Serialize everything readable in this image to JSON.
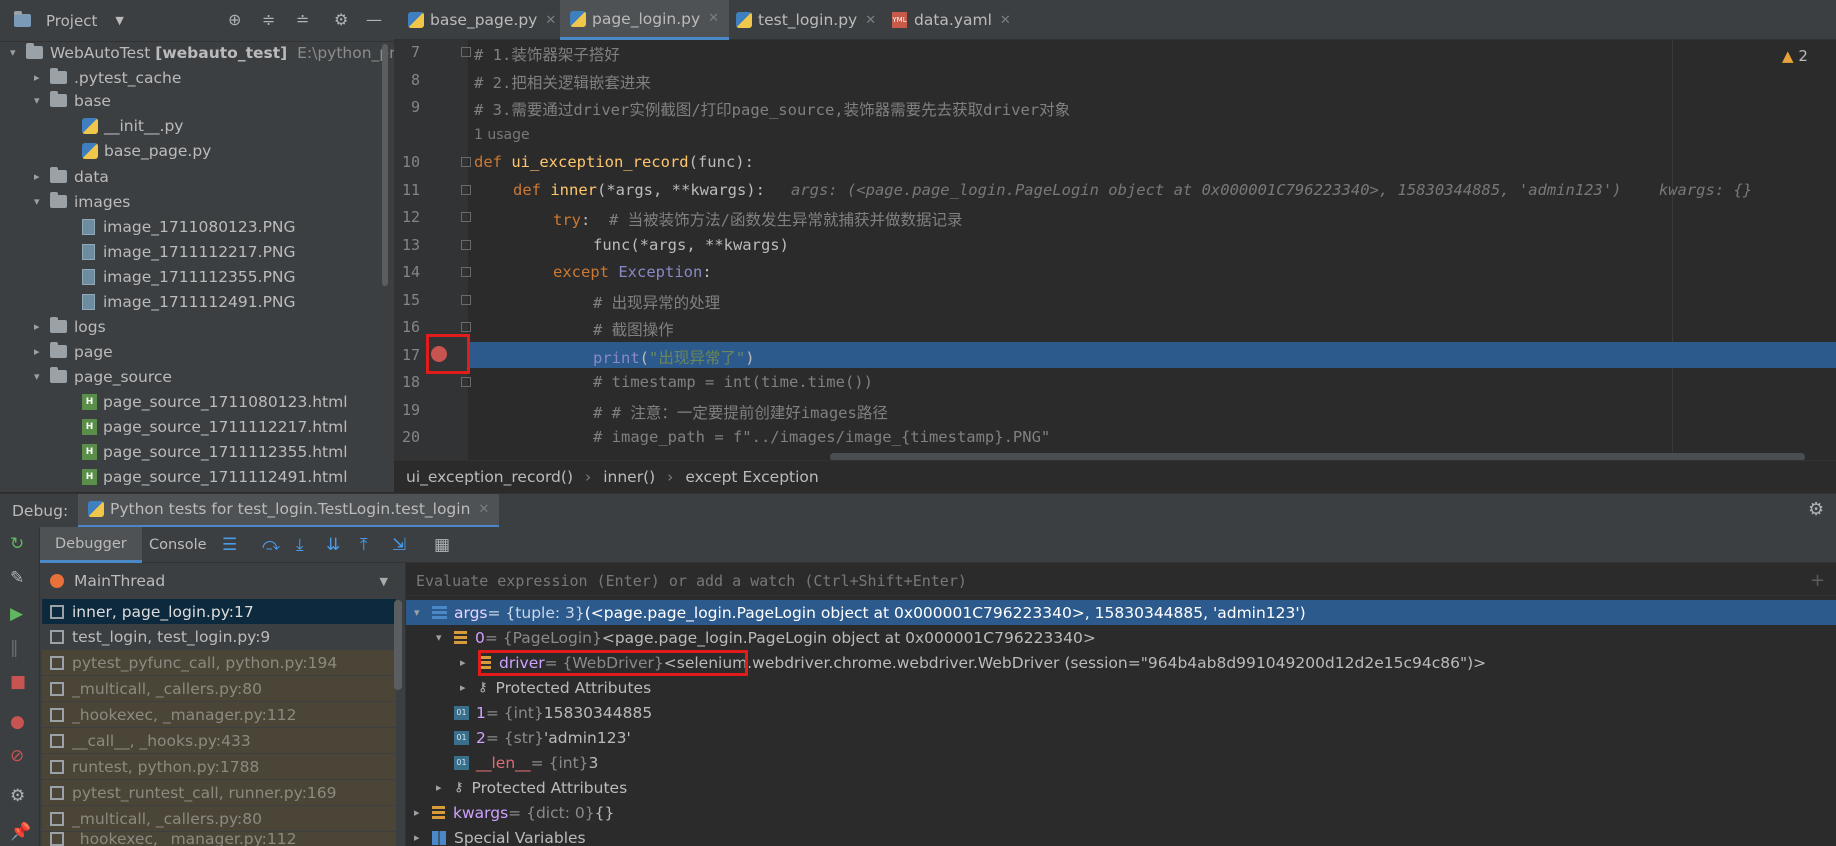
{
  "project_panel": {
    "title": "Project",
    "tree": [
      {
        "label": "WebAutoTest",
        "extra": "[webauto_test]",
        "path": "E:\\python_proj",
        "type": "root",
        "expanded": true
      },
      {
        "label": ".pytest_cache",
        "type": "folder",
        "expanded": false
      },
      {
        "label": "base",
        "type": "folder",
        "expanded": true
      },
      {
        "label": "__init__.py",
        "type": "py"
      },
      {
        "label": "base_page.py",
        "type": "py"
      },
      {
        "label": "data",
        "type": "folder",
        "expanded": false
      },
      {
        "label": "images",
        "type": "folder",
        "expanded": true
      },
      {
        "label": "image_1711080123.PNG",
        "type": "png"
      },
      {
        "label": "image_1711112217.PNG",
        "type": "png"
      },
      {
        "label": "image_1711112355.PNG",
        "type": "png"
      },
      {
        "label": "image_1711112491.PNG",
        "type": "png"
      },
      {
        "label": "logs",
        "type": "folder",
        "expanded": false
      },
      {
        "label": "page",
        "type": "folder",
        "expanded": false
      },
      {
        "label": "page_source",
        "type": "folder",
        "expanded": true
      },
      {
        "label": "page_source_1711080123.html",
        "type": "html"
      },
      {
        "label": "page_source_1711112217.html",
        "type": "html"
      },
      {
        "label": "page_source_1711112355.html",
        "type": "html"
      },
      {
        "label": "page_source_1711112491.html",
        "type": "html"
      }
    ]
  },
  "editor": {
    "tabs": [
      {
        "label": "base_page.py",
        "active": false
      },
      {
        "label": "page_login.py",
        "active": true
      },
      {
        "label": "test_login.py",
        "active": false
      },
      {
        "label": "data.yaml",
        "active": false
      }
    ],
    "warnings": "2",
    "usage_hint": "1 usage",
    "line_numbers": [
      "7",
      "8",
      "9",
      "10",
      "11",
      "12",
      "13",
      "14",
      "15",
      "16",
      "17",
      "18",
      "19",
      "20"
    ],
    "code": {
      "l7": "# 1.装饰器架子搭好",
      "l8": "# 2.把相关逻辑嵌套进来",
      "l9": "# 3.需要通过driver实例截图/打印page_source,装饰器需要先去获取driver对象",
      "l10_kw": "def ",
      "l10_fn": "ui_exception_record",
      "l10_rest": "(func):",
      "l11_kw": "def ",
      "l11_fn": "inner",
      "l11_rest": "(*args, **kwargs):",
      "l11_hint": "args: (<page.page_login.PageLogin object at 0x000001C796223340>, 15830344885, 'admin123')    kwargs: {}",
      "l12_kw": "try",
      "l12_rest": ":  ",
      "l12_cm": "# 当被装饰方法/函数发生异常就捕获并做数据记录",
      "l13": "func(*args, **kwargs)",
      "l14_kw": "except ",
      "l14_cls": "Exception",
      "l14_rest": ":",
      "l15": "# 出现异常的处理",
      "l16": "# 截图操作",
      "l17_fn": "print",
      "l17_p1": "(",
      "l17_st": "\"出现异常了\"",
      "l17_p2": ")",
      "l18": "# timestamp = int(time.time())",
      "l19": "# # 注意：一定要提前创建好images路径",
      "l20": "# image_path = f\"../images/image_{timestamp}.PNG\""
    },
    "breadcrumbs": [
      "ui_exception_record()",
      "inner()",
      "except Exception"
    ]
  },
  "debug": {
    "label": "Debug:",
    "session_tab": "Python tests for test_login.TestLogin.test_login",
    "subtabs": [
      "Debugger",
      "Console"
    ],
    "thread": "MainThread",
    "frames": [
      {
        "label": "inner, page_login.py:17",
        "kind": "sel"
      },
      {
        "label": "test_login, test_login.py:9",
        "kind": "user"
      },
      {
        "label": "pytest_pyfunc_call, python.py:194",
        "kind": "lib"
      },
      {
        "label": "_multicall, _callers.py:80",
        "kind": "lib"
      },
      {
        "label": "_hookexec, _manager.py:112",
        "kind": "lib"
      },
      {
        "label": "__call__, _hooks.py:433",
        "kind": "lib"
      },
      {
        "label": "runtest, python.py:1788",
        "kind": "lib"
      },
      {
        "label": "pytest_runtest_call, runner.py:169",
        "kind": "lib"
      },
      {
        "label": "_multicall, _callers.py:80",
        "kind": "lib"
      },
      {
        "label": "_hookexec, _manager.py:112",
        "kind": "lib"
      }
    ],
    "eval_placeholder": "Evaluate expression (Enter) or add a watch (Ctrl+Shift+Enter)",
    "variables": {
      "args_name": "args",
      "args_type": " = {tuple: 3} ",
      "args_value": "(<page.page_login.PageLogin object at 0x000001C796223340>, 15830344885, 'admin123')",
      "item0_name": "0",
      "item0_type": " = {PageLogin} ",
      "item0_value": "<page.page_login.PageLogin object at 0x000001C796223340>",
      "driver_name": "driver",
      "driver_type": " = {WebDriver} ",
      "driver_value": "<selenium.webdriver.chrome.webdriver.WebDriver (session=\"964b4ab8d991049200d12d2e15c94c86\")>",
      "protected_inner": "Protected Attributes",
      "item1_name": "1",
      "item1_type": " = {int} ",
      "item1_value": "15830344885",
      "item2_name": "2",
      "item2_type": " = {str} ",
      "item2_value": "'admin123'",
      "len_name": "__len__",
      "len_type": " = {int} ",
      "len_value": "3",
      "protected_outer": "Protected Attributes",
      "kwargs_name": "kwargs",
      "kwargs_type": " = {dict: 0} ",
      "kwargs_value": "{}",
      "special": "Special Variables"
    }
  }
}
